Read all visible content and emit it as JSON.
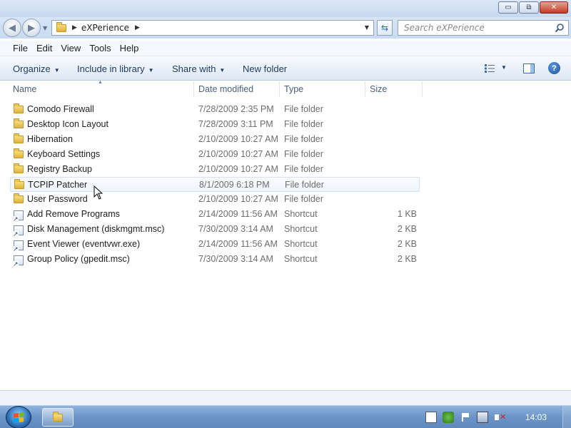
{
  "window": {
    "controls": {
      "minimize": "▭",
      "maximize": "⧉",
      "close": "✕"
    }
  },
  "address": {
    "crumbs": [
      "eXPerience"
    ],
    "search_placeholder": "Search eXPerience"
  },
  "menu": [
    "File",
    "Edit",
    "View",
    "Tools",
    "Help"
  ],
  "toolbar": {
    "organize": "Organize",
    "include_in_library": "Include in library",
    "share_with": "Share with",
    "new_folder": "New folder"
  },
  "columns": {
    "name": "Name",
    "date": "Date modified",
    "type": "Type",
    "size": "Size"
  },
  "files": [
    {
      "name": "Comodo Firewall",
      "date": "7/28/2009 2:35 PM",
      "type": "File folder",
      "size": "",
      "icon": "folder-icon"
    },
    {
      "name": "Desktop Icon Layout",
      "date": "7/28/2009 3:11 PM",
      "type": "File folder",
      "size": "",
      "icon": "folder-icon"
    },
    {
      "name": "Hibernation",
      "date": "2/10/2009 10:27 AM",
      "type": "File folder",
      "size": "",
      "icon": "folder-icon"
    },
    {
      "name": "Keyboard Settings",
      "date": "2/10/2009 10:27 AM",
      "type": "File folder",
      "size": "",
      "icon": "folder-icon"
    },
    {
      "name": "Registry Backup",
      "date": "2/10/2009 10:27 AM",
      "type": "File folder",
      "size": "",
      "icon": "folder-icon"
    },
    {
      "name": "TCPIP Patcher",
      "date": "8/1/2009 6:18 PM",
      "type": "File folder",
      "size": "",
      "icon": "folder-icon",
      "hover": true
    },
    {
      "name": "User Password",
      "date": "2/10/2009 10:27 AM",
      "type": "File folder",
      "size": "",
      "icon": "folder-icon"
    },
    {
      "name": "Add Remove Programs",
      "date": "2/14/2009 11:56 AM",
      "type": "Shortcut",
      "size": "1 KB",
      "icon": "shortcut-icon"
    },
    {
      "name": "Disk Management (diskmgmt.msc)",
      "date": "7/30/2009 3:14 AM",
      "type": "Shortcut",
      "size": "2 KB",
      "icon": "shortcut-icon"
    },
    {
      "name": "Event Viewer (eventvwr.exe)",
      "date": "2/14/2009 11:56 AM",
      "type": "Shortcut",
      "size": "2 KB",
      "icon": "shortcut-icon"
    },
    {
      "name": "Group Policy (gpedit.msc)",
      "date": "7/30/2009 3:14 AM",
      "type": "Shortcut",
      "size": "2 KB",
      "icon": "shortcut-icon"
    }
  ],
  "taskbar": {
    "clock": "14:03",
    "tray_icons": [
      "action-center-icon",
      "security-shield-icon",
      "flag-icon",
      "network-icon",
      "volume-muted-icon"
    ]
  }
}
